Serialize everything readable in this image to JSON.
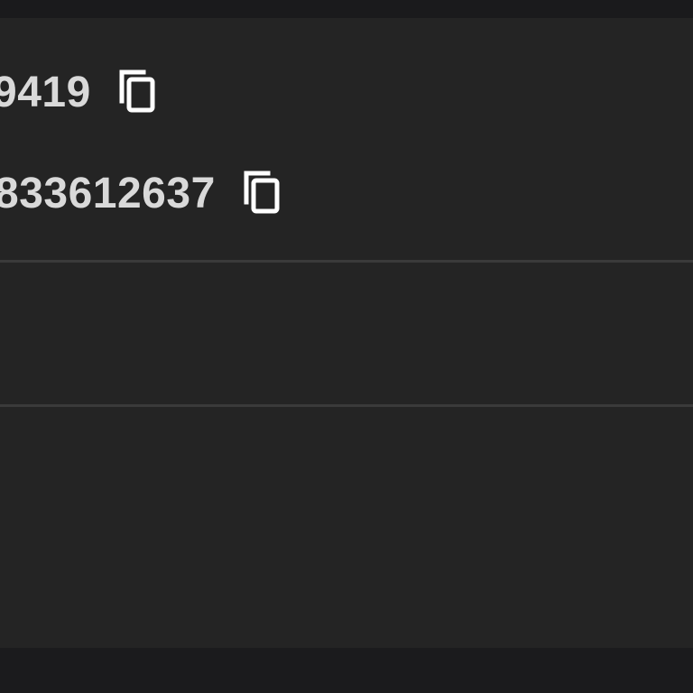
{
  "fields": [
    {
      "value": "9419",
      "action_icon": "copy-icon"
    },
    {
      "value": "833612637",
      "action_icon": "copy-icon"
    }
  ],
  "colors": {
    "background": "#242424",
    "frame": "#1a1a1c",
    "text": "#d9d9d9",
    "divider": "#3a3a3a",
    "icon": "#ffffff"
  }
}
